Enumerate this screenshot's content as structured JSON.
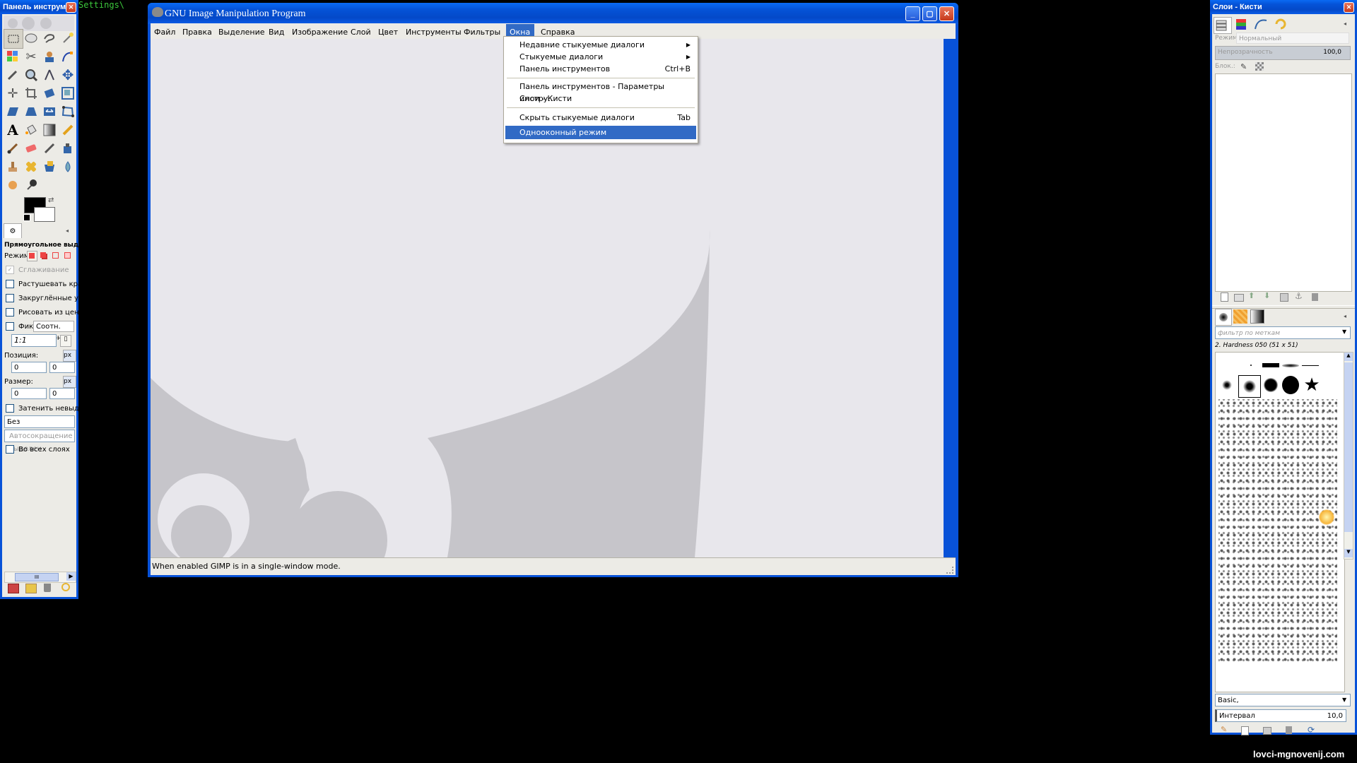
{
  "terminal_text": "Settings\\",
  "watermark": "lovci-mgnovenij.com",
  "toolbox": {
    "title": "Панель инструме...",
    "tool_options_title": "Прямоугольное выдел",
    "mode_label": "Режим:",
    "antialiasing": "Сглаживание",
    "feather": "Растушевать края",
    "rounded": "Закруглённые углы",
    "from_center": "Рисовать из центра",
    "fixed_label": "Фикс.:",
    "fixed_value": "Соотн. сторон",
    "ratio_value": "1:1",
    "position_label": "Позиция:",
    "size_label": "Размер:",
    "unit": "px",
    "pos_x": "0",
    "pos_y": "0",
    "size_w": "0",
    "size_h": "0",
    "highlight": "Затенить невыделен",
    "guides": "Без направляющих",
    "autoshrink": "Автосокращение выделен",
    "all_layers": "Во всех слоях",
    "scroll_grip": "III"
  },
  "main": {
    "title": "GNU Image Manipulation Program",
    "menu": [
      "Файл",
      "Правка",
      "Выделение",
      "Вид",
      "Изображение",
      "Слой",
      "Цвет",
      "Инструменты",
      "Фильтры",
      "Окна",
      "Справка"
    ],
    "status": "When enabled GIMP is in a single-window mode."
  },
  "windows_menu": {
    "items": [
      {
        "label": "Недавние стыкуемые диалоги",
        "accel": "",
        "submenu": true
      },
      {
        "label": "Стыкуемые диалоги",
        "accel": "",
        "submenu": true
      },
      {
        "label": "Панель инструментов",
        "accel": "Ctrl+B",
        "submenu": false
      },
      {
        "label": "Панель инструментов - Параметры инстру...",
        "accel": "",
        "submenu": false
      },
      {
        "label": "Слои - Кисти",
        "accel": "",
        "submenu": false
      },
      {
        "label": "Скрыть стыкуемые диалоги",
        "accel": "Tab",
        "submenu": false
      },
      {
        "label": "Однооконный режим",
        "accel": "",
        "submenu": false,
        "highlighted": true
      }
    ]
  },
  "dock": {
    "title": "Слои - Кисти",
    "mode_label": "Режим:",
    "mode_value": "Нормальный",
    "opacity_label": "Непрозрачность",
    "opacity_value": "100,0",
    "lock_label": "Блок.:",
    "filter_placeholder": "фильтр по меткам",
    "brush_name": "2. Hardness 050 (51 x 51)",
    "preset": "Basic,",
    "spacing_label": "Интервал",
    "spacing_value": "10,0"
  },
  "colors": {
    "accent": "#316ac5",
    "canvas": "#e8e7ec",
    "wilber": "#c6c5ca"
  }
}
